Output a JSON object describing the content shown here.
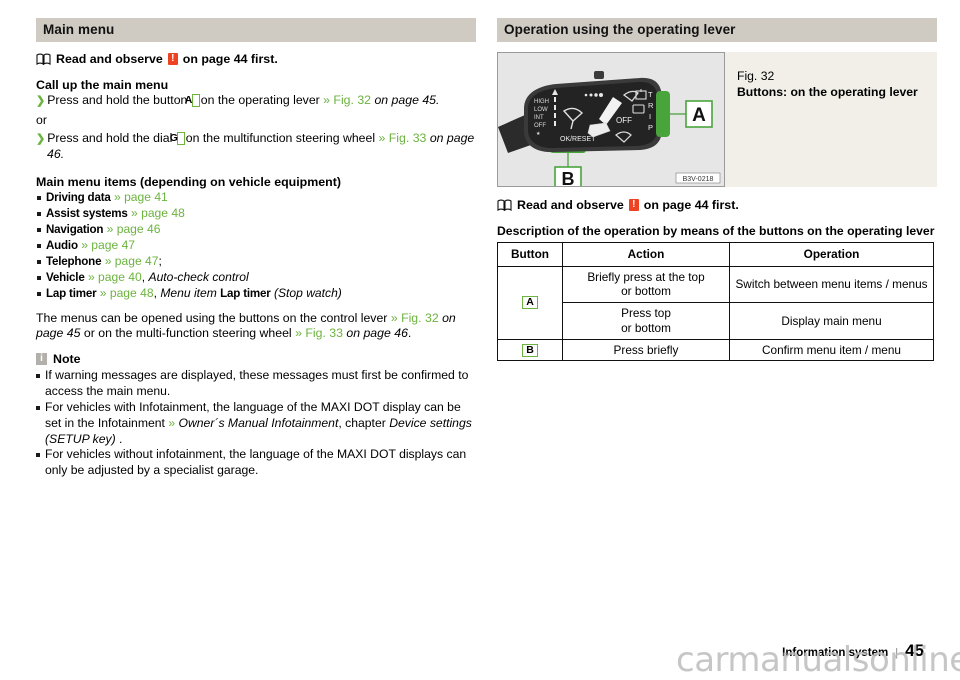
{
  "left": {
    "section_title": "Main menu",
    "observe": {
      "icon": "book-icon",
      "text_before": "Read and observe",
      "warn_glyph": "!",
      "text_after": "on page 44 first."
    },
    "callup": {
      "heading": "Call up the main menu",
      "item1_pre": "Press and hold the button",
      "item1_key": "A",
      "item1_mid": "on the operating lever",
      "item1_ref": "» Fig. 32",
      "item1_ref_ital": "on page 45",
      "item1_end": ".",
      "or": "or",
      "item2_pre": "Press and hold the dial",
      "item2_key": "G",
      "item2_mid": "on the multifunction steering wheel",
      "item2_ref": "» Fig. 33",
      "item2_ref_ital": "on page 46",
      "item2_end": "."
    },
    "menu_items": {
      "heading": "Main menu items (depending on vehicle equipment)",
      "rows": [
        {
          "name": "Driving data",
          "ref": "» page 41",
          "tail": "",
          "tail_ital": ""
        },
        {
          "name": "Assist systems",
          "ref": "» page 48",
          "tail": "",
          "tail_ital": ""
        },
        {
          "name": "Navigation",
          "ref": "» page 46",
          "tail": "",
          "tail_ital": ""
        },
        {
          "name": "Audio",
          "ref": "» page 47",
          "tail": "",
          "tail_ital": ""
        },
        {
          "name": "Telephone",
          "ref": "» page 47",
          "tail": ";",
          "tail_ital": ""
        },
        {
          "name": "Vehicle",
          "ref": "» page 40",
          "tail": ",",
          "tail_ital": "Auto-check control"
        },
        {
          "name": "Lap timer",
          "ref": "» page 48",
          "tail": ",",
          "tail_ital": "Menu item",
          "tail_name": "Lap timer",
          "tail_ital2": "(Stop watch)"
        }
      ]
    },
    "menus_para": {
      "t1": "The menus can be opened using the buttons on the control lever",
      "ref1": "» Fig. 32",
      "ref1_ital": "on page 45",
      "t2": "or on the multi-function steering wheel",
      "ref2": "» Fig. 33",
      "ref2_ital": "on page 46",
      "t3": "."
    },
    "note": {
      "icon_glyph": "i",
      "title": "Note",
      "items": [
        {
          "text": "If warning messages are displayed, these messages must first be confirmed to access the main menu."
        },
        {
          "pre": "For vehicles with Infotainment, the language of the MAXI DOT display can be set in the Infotainment",
          "ref": "»",
          "ital1": "Owner´s Manual Infotainment",
          "mid": ", chapter",
          "ital2": "Device settings (SETUP key)",
          "post": "."
        },
        {
          "text": "For vehicles without infotainment, the language of the MAXI DOT displays can only be adjusted by a specialist garage."
        }
      ]
    }
  },
  "right": {
    "section_title": "Operation using the operating lever",
    "figure": {
      "image_code": "B3V-0218",
      "labels": [
        "A",
        "B"
      ],
      "lever_markings": [
        "HIGH",
        "LOW",
        "INT",
        "OFF",
        "OK/RESET",
        "OFF",
        "T",
        "R",
        "I",
        "P"
      ],
      "caption_number": "Fig. 32",
      "caption_text": "Buttons: on the operating lever"
    },
    "observe": {
      "icon": "book-icon",
      "text_before": "Read and observe",
      "warn_glyph": "!",
      "text_after": "on page 44 first."
    },
    "table_caption": "Description of the operation by means of the buttons on the operating lever",
    "table": {
      "headers": [
        "Button",
        "Action",
        "Operation"
      ],
      "rows": [
        {
          "button": "A",
          "rowspan": 2,
          "action": "Briefly press at the top\nor bottom",
          "operation": "Switch between menu items / menus"
        },
        {
          "button": "",
          "rowspan": 0,
          "action": "Press top\nor bottom",
          "operation": "Display main menu"
        },
        {
          "button": "B",
          "rowspan": 1,
          "action": "Press briefly",
          "operation": "Confirm menu item / menu"
        }
      ]
    }
  },
  "footer": {
    "chapter": "Information system",
    "separator": "|",
    "page_number": "45",
    "watermark": "carmanualsonline.info"
  },
  "colors": {
    "header_bar": "#cfcac2",
    "accent_green": "#6cb33f",
    "warn_red": "#ef4223",
    "note_grey": "#b3b0ab",
    "figure_bg": "#f2efe9"
  }
}
